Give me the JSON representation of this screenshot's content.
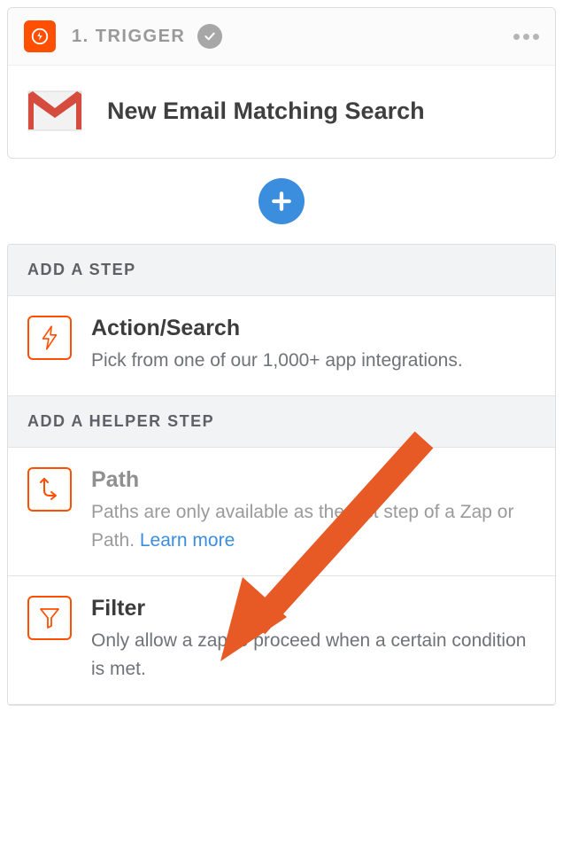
{
  "trigger": {
    "label": "1. TRIGGER",
    "title": "New Email Matching Search"
  },
  "sections": {
    "add_step": "ADD A STEP",
    "add_helper": "ADD A HELPER STEP"
  },
  "steps": {
    "action": {
      "title": "Action/Search",
      "desc": "Pick from one of our 1,000+ app integrations."
    },
    "path": {
      "title": "Path",
      "desc_prefix": "Paths are only available as the last step of a Zap or Path. ",
      "learn_more": "Learn more"
    },
    "filter": {
      "title": "Filter",
      "desc": "Only allow a zap to proceed when a certain condition is met."
    }
  }
}
